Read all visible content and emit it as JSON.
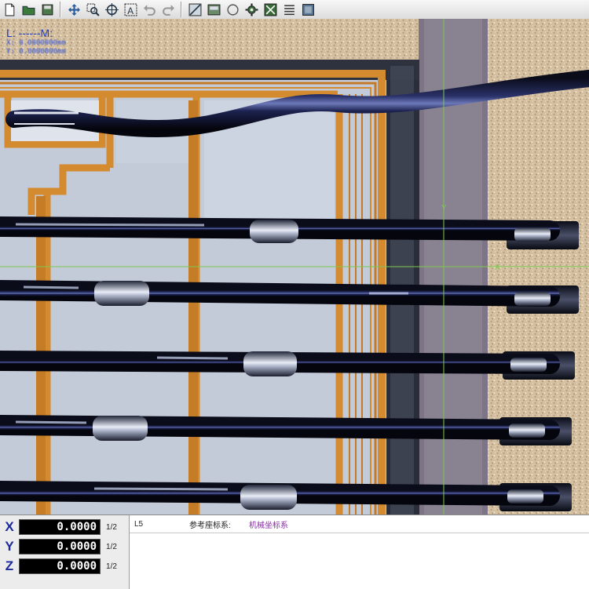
{
  "toolbar": {
    "icons": [
      "new-file-icon",
      "open-folder-icon",
      "save-icon",
      "move-icon",
      "zoom-window-icon",
      "crosshair-icon",
      "auto-text-icon",
      "undo-icon",
      "redo-icon",
      "edge-detect-icon",
      "image-panel-icon",
      "circle-tool-icon",
      "settings-gear-icon",
      "fit-window-icon",
      "list-icon",
      "frame-icon"
    ]
  },
  "overlay": {
    "length_label": "L: ------M:",
    "line1": "X: 0.0000000mm",
    "line2": "Y: 0.0000000mm",
    "y_axis_label": "Y",
    "x_axis_label": "X"
  },
  "dro": {
    "x": {
      "axis": "X",
      "value": "0.0000",
      "divider": "1/2"
    },
    "y": {
      "axis": "Y",
      "value": "0.0000",
      "divider": "1/2"
    },
    "z": {
      "axis": "Z",
      "value": "0.0000",
      "divider": "1/2"
    }
  },
  "info": {
    "element": "L5",
    "ref_label": "参考座标系:",
    "ref_value": "机械坐标系"
  },
  "colors": {
    "crosshair": "#7ec850",
    "dro_value": "#ffffff",
    "ref_value": "#8a2aa6"
  }
}
